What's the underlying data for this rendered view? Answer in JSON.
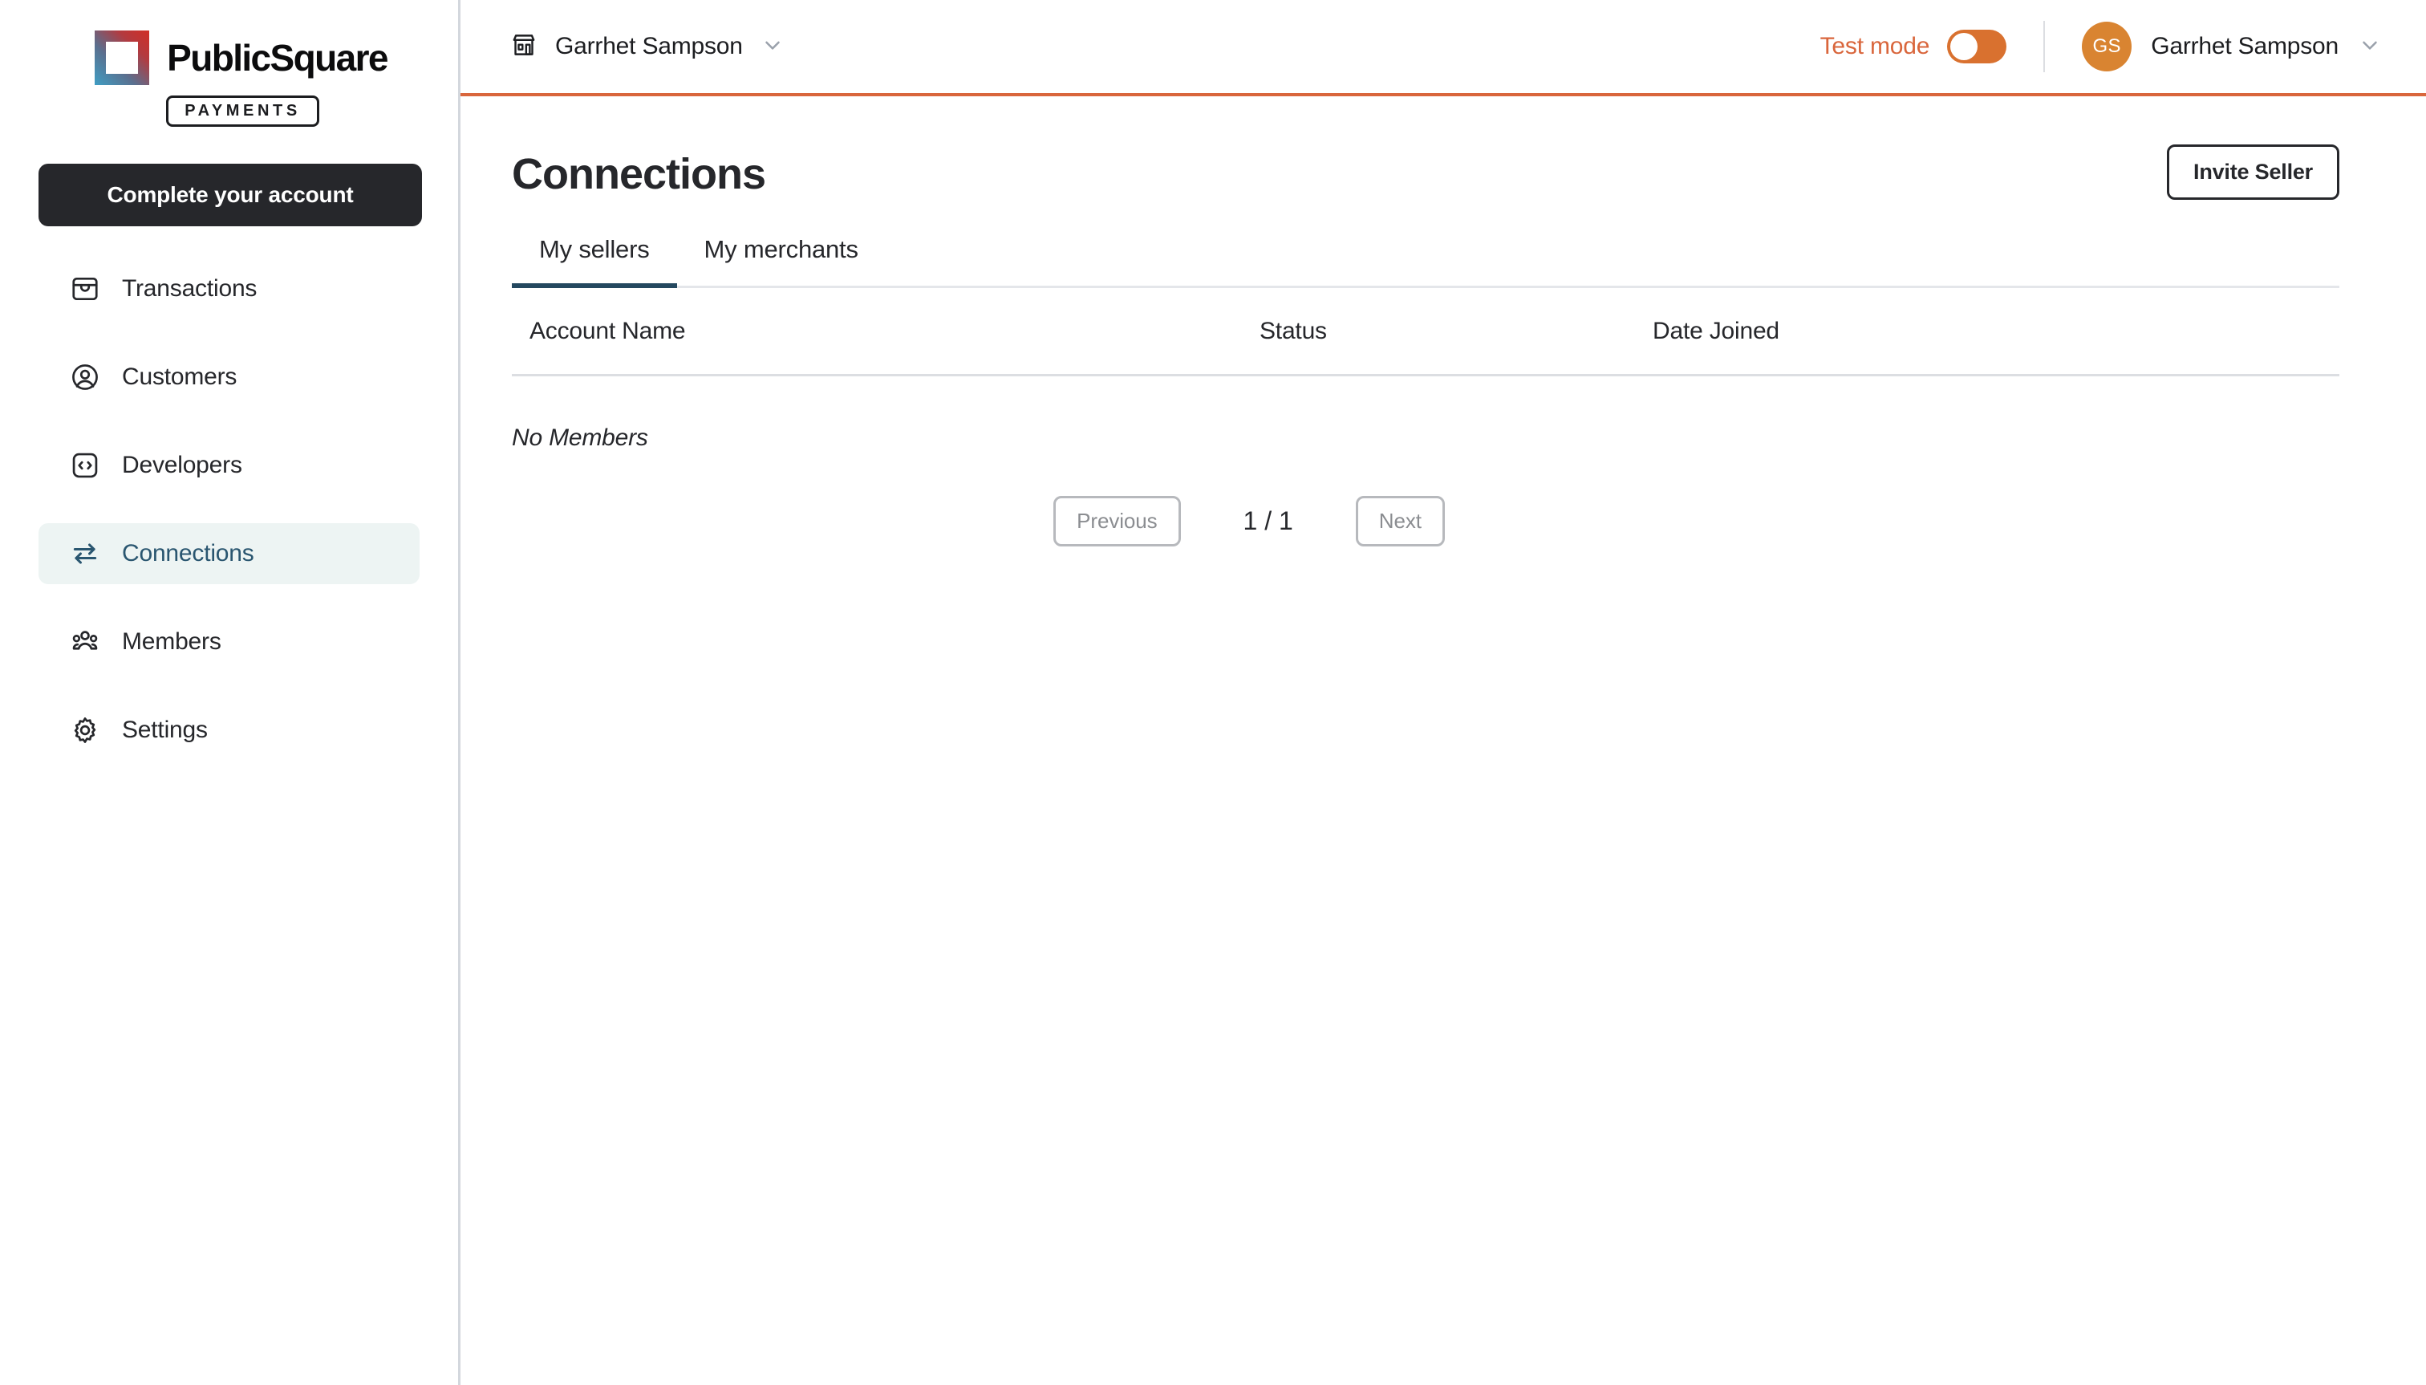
{
  "brand": {
    "name": "PublicSquare",
    "badge": "PAYMENTS",
    "logo_icon": "gradient-square-logo",
    "gradient_from": "#d12e26",
    "gradient_to": "#3f9ec4"
  },
  "sidebar": {
    "cta_label": "Complete your account",
    "items": [
      {
        "label": "Transactions",
        "icon": "inbox-icon",
        "active": false
      },
      {
        "label": "Customers",
        "icon": "user-circle-icon",
        "active": false
      },
      {
        "label": "Developers",
        "icon": "code-brackets-icon",
        "active": false
      },
      {
        "label": "Connections",
        "icon": "transfer-arrows-icon",
        "active": true
      },
      {
        "label": "Members",
        "icon": "users-group-icon",
        "active": false
      },
      {
        "label": "Settings",
        "icon": "gear-icon",
        "active": false
      }
    ],
    "active_bg": "#edf4f3",
    "active_fg": "#2a5670"
  },
  "topbar": {
    "store_icon": "storefront-icon",
    "store_name": "Garrhet Sampson",
    "store_chevron": "chevron-down-icon",
    "test_mode_label": "Test mode",
    "test_mode_on": false,
    "test_mode_color": "#d9663c",
    "avatar_initials": "GS",
    "avatar_color": "#d98431",
    "user_name": "Garrhet Sampson",
    "user_chevron": "chevron-down-icon",
    "accent_rule_color": "#d9663c"
  },
  "main": {
    "page_title": "Connections",
    "invite_button_label": "Invite Seller",
    "tabs": [
      {
        "label": "My sellers",
        "active": true
      },
      {
        "label": "My merchants",
        "active": false
      }
    ],
    "tab_active_color": "#24485f",
    "table": {
      "columns": [
        {
          "key": "account_name",
          "label": "Account Name"
        },
        {
          "key": "status",
          "label": "Status"
        },
        {
          "key": "date_joined",
          "label": "Date Joined"
        }
      ],
      "rows": [],
      "empty_message": "No Members"
    },
    "pagination": {
      "previous_label": "Previous",
      "next_label": "Next",
      "indicator": "1 / 1",
      "previous_disabled": true,
      "next_disabled": true
    }
  }
}
